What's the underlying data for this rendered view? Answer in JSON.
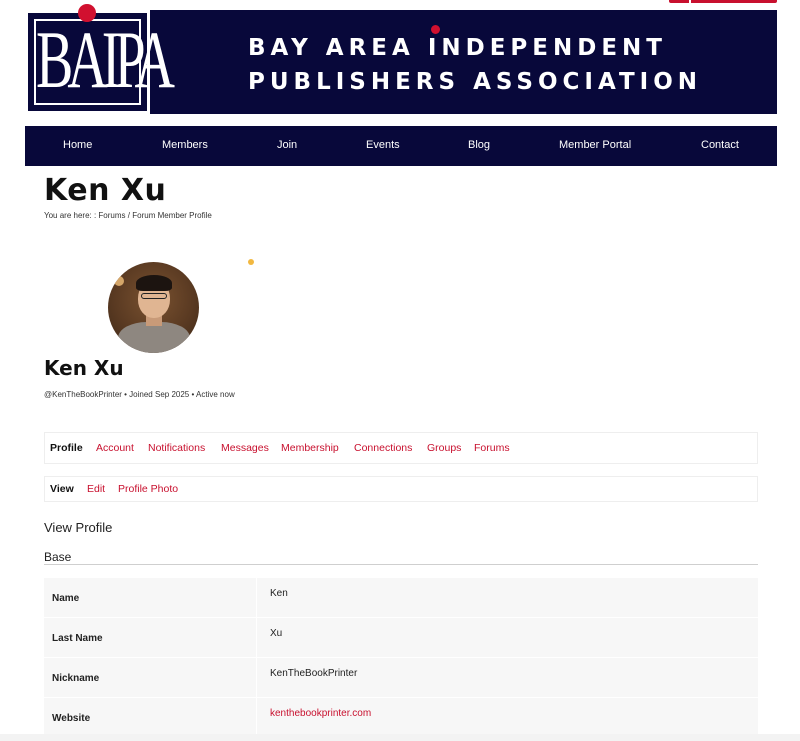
{
  "header": {
    "logo_text": "BAIPA",
    "title_line1": "BAY AREA INDEPENDENT",
    "title_line2": "PUBLISHERS ASSOCIATION"
  },
  "nav": {
    "items": [
      {
        "label": "Home"
      },
      {
        "label": "Members"
      },
      {
        "label": "Join"
      },
      {
        "label": "Events"
      },
      {
        "label": "Blog"
      },
      {
        "label": "Member Portal"
      },
      {
        "label": "Contact"
      }
    ]
  },
  "page": {
    "title": "Ken Xu",
    "breadcrumb_prefix": "You are here: :",
    "breadcrumb_items": [
      "Forums",
      "Forum Member Profile"
    ],
    "breadcrumb_sep": "/"
  },
  "profile": {
    "name": "Ken Xu",
    "meta": "@KenTheBookPrinter • Joined Sep 2025 • Active now",
    "status_color": "#f2b840"
  },
  "tabs": {
    "primary": [
      "Profile",
      "Account",
      "Notifications",
      "Messages",
      "Membership",
      "Connections",
      "Groups",
      "Forums"
    ],
    "secondary": [
      "View",
      "Edit",
      "Profile Photo"
    ]
  },
  "content": {
    "section_title": "View Profile",
    "group_title": "Base",
    "fields": [
      {
        "label": "Name",
        "value": "Ken"
      },
      {
        "label": "Last Name",
        "value": "Xu"
      },
      {
        "label": "Nickname",
        "value": "KenTheBookPrinter"
      },
      {
        "label": "Website",
        "value": "kenthebookprinter.com"
      }
    ]
  },
  "colors": {
    "brand_navy": "#08083a",
    "accent_red": "#c8102e"
  }
}
